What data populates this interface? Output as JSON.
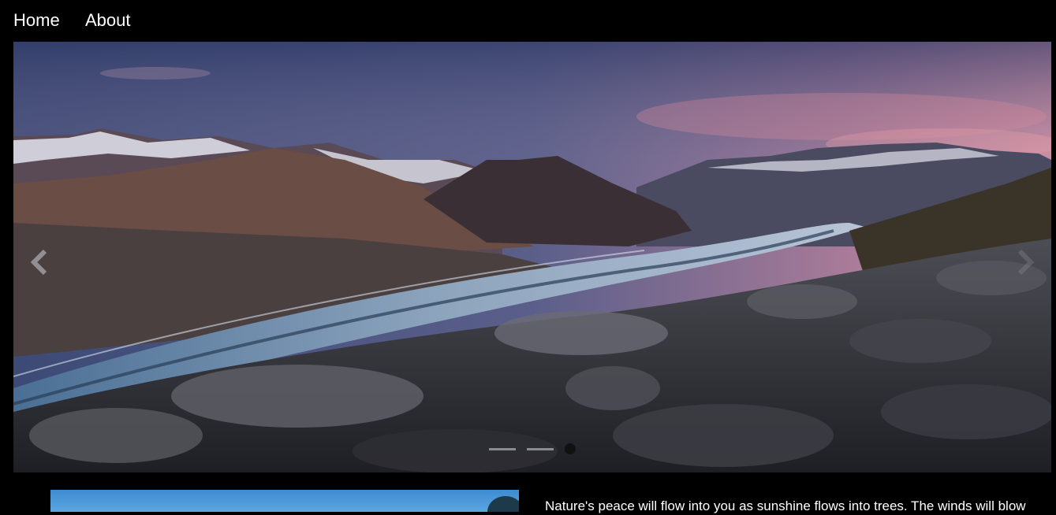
{
  "nav": {
    "items": [
      {
        "label": "Home"
      },
      {
        "label": "About"
      }
    ]
  },
  "carousel": {
    "slide_count": 3,
    "active_index": 2,
    "prev_icon": "chevron-left-icon",
    "next_icon": "chevron-right-icon"
  },
  "content": {
    "paragraph": "Nature's peace will flow into you as sunshine flows into trees. The winds will blow"
  },
  "colors": {
    "background": "#000000",
    "text": "#ffffff"
  }
}
